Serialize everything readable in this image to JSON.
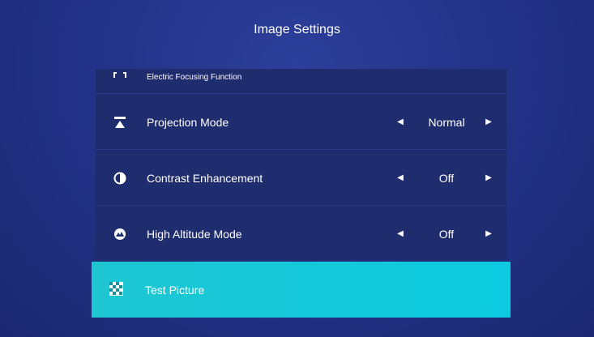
{
  "page": {
    "title": "Image Settings"
  },
  "menu": {
    "items": [
      {
        "icon": "focus-bracket-icon",
        "label": "Electric Focusing Function"
      },
      {
        "icon": "projection-icon",
        "label": "Projection Mode",
        "value": "Normal",
        "left_arrow": "◀",
        "right_arrow": "▶"
      },
      {
        "icon": "contrast-icon",
        "label": "Contrast Enhancement",
        "value": "Off",
        "left_arrow": "◀",
        "right_arrow": "▶"
      },
      {
        "icon": "mountain-icon",
        "label": "High Altitude Mode",
        "value": "Off",
        "left_arrow": "◀",
        "right_arrow": "▶"
      },
      {
        "icon": "checkerboard-icon",
        "label": "Test Picture",
        "selected": true
      }
    ]
  },
  "colors": {
    "background": "#23338a",
    "row": "#1f2c6e",
    "highlight": "#0ccbe0"
  }
}
